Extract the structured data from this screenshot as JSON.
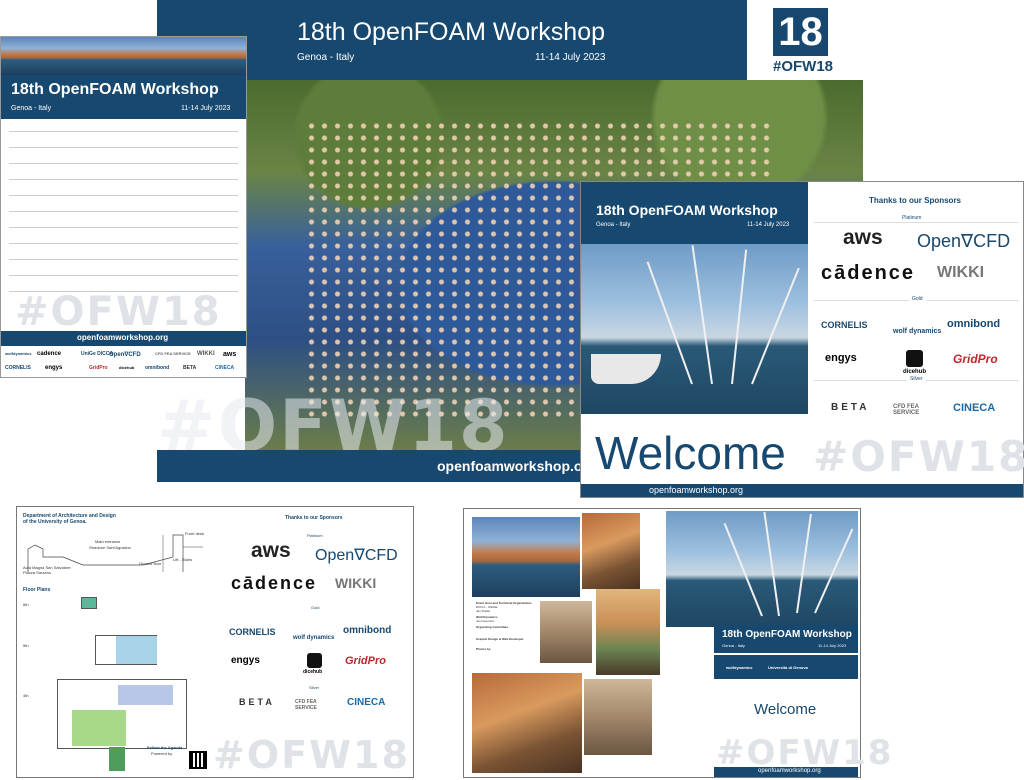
{
  "main_banner": {
    "title": "18th OpenFOAM Workshop",
    "location": "Genoa - Italy",
    "dates": "11-14 July 2023",
    "logo_number": "18",
    "logo_tag": "#OFW18",
    "watermark": "#OFW18",
    "url": "openfoamworkshop.org"
  },
  "notepad": {
    "title": "18th OpenFOAM Workshop",
    "location": "Genoa - Italy",
    "dates": "11-14 July 2023",
    "watermark": "#OFW18",
    "url": "openfoamworkshop.org",
    "sponsors_row1": [
      "wolfdynamics",
      "cadence",
      "UniGe DICCA",
      "Open∇CFD",
      "CFD FEA SERVICE",
      "WIKKI",
      "aws"
    ],
    "sponsors_row2": [
      "CORNELIS",
      "engys",
      "GridPro",
      "dicehub",
      "omnibond",
      "BETA",
      "CINECA"
    ]
  },
  "welcome_slide": {
    "title": "18th OpenFOAM Workshop",
    "location": "Genoa - Italy",
    "dates": "11-14 July 2023",
    "sponsors_heading": "Thanks to our Sponsors",
    "tier_platinum": "Platinum",
    "tier_gold": "Gold",
    "tier_silver": "Silver",
    "platinum": [
      "aws",
      "Open∇CFD",
      "cādence",
      "WIKKI"
    ],
    "gold": [
      "CORNELIS",
      "wolf dynamics",
      "omnibond",
      "engys",
      "dicehub",
      "GridPro"
    ],
    "silver": [
      "BETA",
      "CFD FEA SERVICE",
      "CINECA"
    ],
    "welcome": "Welcome",
    "watermark": "#OFW18",
    "url": "openfoamworkshop.org"
  },
  "map_sheet": {
    "dept": "Department of Architecture and Design",
    "dept2": "of the University of Genoa.",
    "main_entrance": "Main entrance",
    "street": "Stradone Sant'Agostino",
    "aula": "Aula Magna San Salvatore",
    "piazza": "Piazza Sarzano",
    "front_desk": "Front desk",
    "ground_floor": "Ground floor",
    "lift": "Lift - Stairs",
    "floor_plans": "Floor Plans",
    "floor6": "6th",
    "floor5": "5th",
    "floor4": "4th",
    "sponsors_heading": "Thanks to our Sponsors",
    "tier_platinum": "Platinum",
    "tier_gold": "Gold",
    "tier_silver": "Silver",
    "platinum": [
      "aws",
      "Open∇CFD",
      "cādence",
      "WIKKI"
    ],
    "gold": [
      "CORNELIS",
      "wolf dynamics",
      "omnibond",
      "engys",
      "dicehub",
      "GridPro"
    ],
    "silver": [
      "BETA",
      "CFD FEA SERVICE",
      "CINECA"
    ],
    "follow": "Follow the Agenda",
    "powered": "Powered by",
    "watermark": "#OFW18"
  },
  "booklet": {
    "title": "18th OpenFOAM Workshop",
    "location": "Genoa - Italy",
    "dates": "11-14 July 2023",
    "welcome": "Welcome",
    "watermark": "#OFW18",
    "url": "openfoamworkshop.org",
    "credits": [
      "Event Host and Technical Organization",
      "DICCA - UNIGE",
      "Jan Pralits",
      "Wolf Dynamics",
      "Joel Guerrero",
      "Organizing Committee",
      "Graphic Design & Web Developer",
      "Photos by"
    ],
    "footer_logos": [
      "wolfdynamics",
      "Università di Genova"
    ]
  },
  "colors": {
    "navy": "#17486f",
    "watermark": "#dfe3e8"
  }
}
